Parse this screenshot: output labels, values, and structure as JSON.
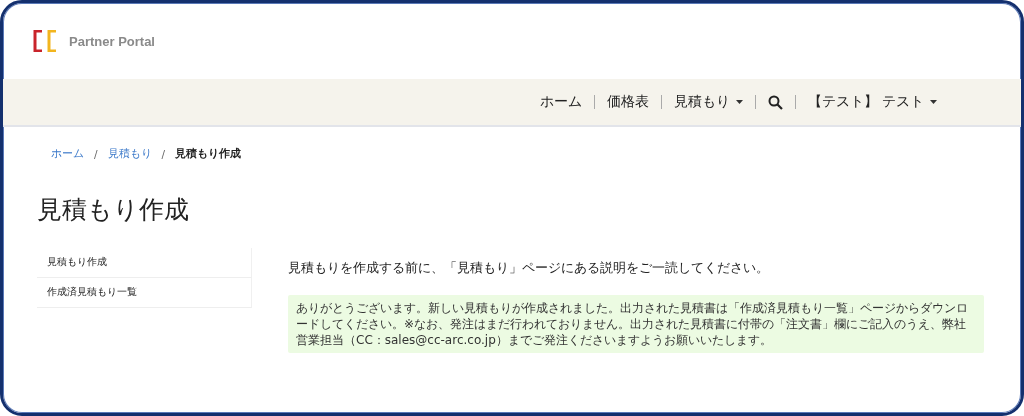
{
  "logo": {
    "text": "Partner Portal"
  },
  "nav": [
    {
      "kind": "link",
      "label": "ホーム"
    },
    {
      "kind": "link",
      "label": "価格表"
    },
    {
      "kind": "dropdown",
      "label": "見積もり"
    },
    {
      "kind": "search"
    },
    {
      "kind": "dropdown",
      "label": "【テスト】 テスト"
    }
  ],
  "breadcrumb_separator": "/",
  "breadcrumb": [
    {
      "label": "ホーム",
      "current": false
    },
    {
      "label": "見積もり",
      "current": false
    },
    {
      "label": "見積もり作成",
      "current": true
    }
  ],
  "page_title": "見積もり作成",
  "sidebar": {
    "items": [
      {
        "label": "見積もり作成"
      },
      {
        "label": "作成済見積もり一覧"
      }
    ]
  },
  "intro": "見積もりを作成する前に、「見積もり」ページにある説明をご一読してください。",
  "alert": {
    "text": "ありがとうございます。新しい見積もりが作成されました。出力された見積書は「作成済見積もり一覧」ページからダウンロードしてください。※なお、発注はまだ行われておりません。出力された見積書に付帯の「注文書」欄にご記入のうえ、弊社営業担当（CC：sales@cc-arc.co.jp）までご発注くださいますようお願いいたします。"
  }
}
